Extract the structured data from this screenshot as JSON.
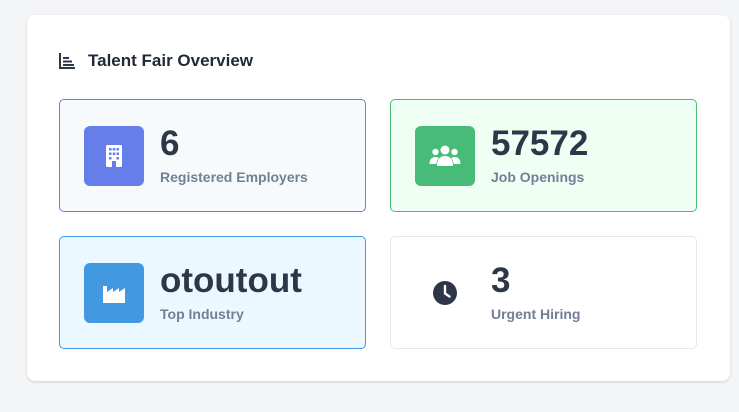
{
  "overview": {
    "title": "Talent Fair Overview",
    "icon": "bar-chart-icon"
  },
  "stats": [
    {
      "value": "6",
      "label": "Registered Employers",
      "icon": "building-icon",
      "icon_bg": "#667eea",
      "card_bg": "#f7fafc",
      "card_border": "#667eea"
    },
    {
      "value": "57572",
      "label": "Job Openings",
      "icon": "users-icon",
      "icon_bg": "#48bb78",
      "card_bg": "#f0fff4",
      "card_border": "#48bb78"
    },
    {
      "value": "otoutout",
      "label": "Top Industry",
      "icon": "industry-icon",
      "icon_bg": "#4299e1",
      "card_bg": "#ebf8ff",
      "card_border": "#4299e1"
    },
    {
      "value": "3",
      "label": "Urgent Hiring",
      "icon": "clock-icon",
      "icon_bg": "",
      "card_bg": "#ffffff",
      "card_border": "#e2e8f0"
    }
  ]
}
